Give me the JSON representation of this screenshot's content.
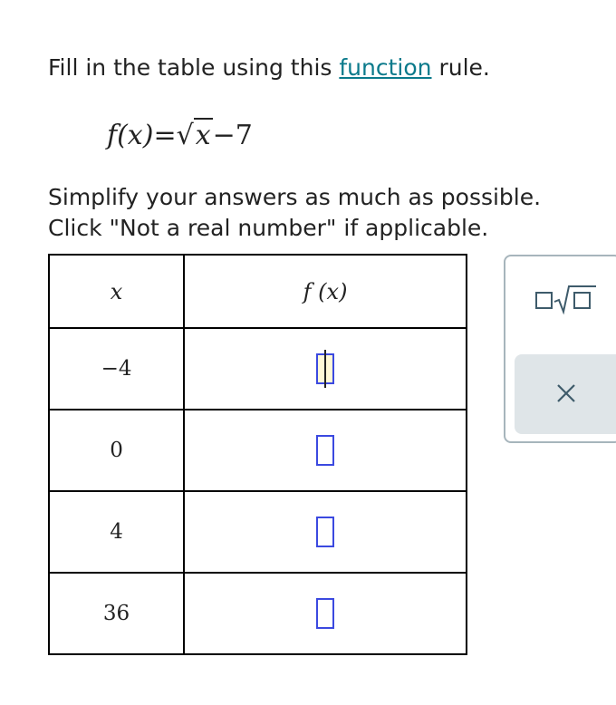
{
  "instruction": {
    "prefix": "Fill in the table using this ",
    "link": "function",
    "suffix": " rule."
  },
  "formula": {
    "lhs": "f(x)",
    "equals": "=",
    "radicand": "x",
    "tail": "−7"
  },
  "simplify": {
    "line1": "Simplify your answers as much as possible.",
    "line2": "Click \"Not a real number\" if applicable."
  },
  "table": {
    "header_x": "x",
    "header_f": "f (x)",
    "rows": [
      {
        "x": "−4",
        "answer": ""
      },
      {
        "x": "0",
        "answer": ""
      },
      {
        "x": "4",
        "answer": ""
      },
      {
        "x": "36",
        "answer": ""
      }
    ]
  },
  "toolbar": {
    "sqrt_icon": "square-root-icon",
    "clear_icon": "close-icon"
  },
  "colors": {
    "link": "#0b7a8b",
    "answer_box_border": "#3b49e0",
    "panel_border": "#a7b5bc",
    "clear_button_bg": "#dfe5e8",
    "icon_color": "#3e5b6b"
  }
}
